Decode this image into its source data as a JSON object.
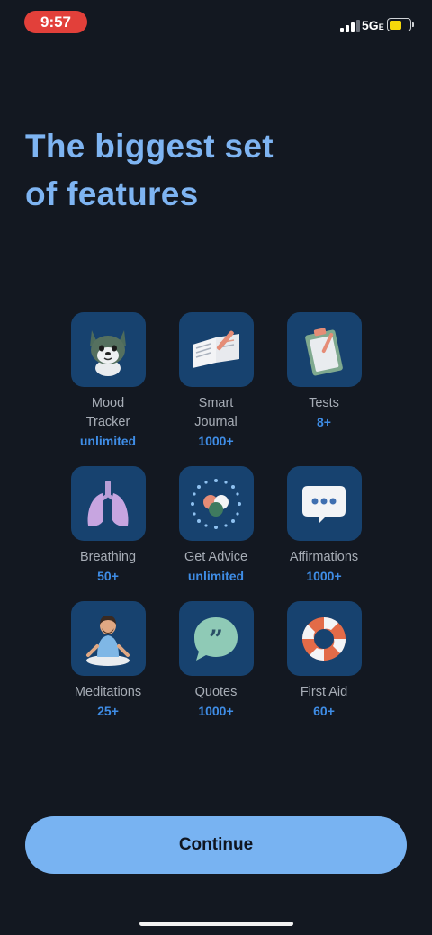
{
  "status_bar": {
    "time": "9:57",
    "network": "5G",
    "network_sub": "E",
    "battery_color": "#f5d90a"
  },
  "title_line1": "The biggest set",
  "title_line2": "of features",
  "features": [
    {
      "label_line1": "Mood",
      "label_line2": "Tracker",
      "count": "unlimited",
      "icon": "wolf-mascot-icon"
    },
    {
      "label_line1": "Smart",
      "label_line2": "Journal",
      "count": "1000+",
      "icon": "journal-icon"
    },
    {
      "label_line1": "Tests",
      "label_line2": "",
      "count": "8+",
      "icon": "clipboard-icon"
    },
    {
      "label_line1": "Breathing",
      "label_line2": "",
      "count": "50+",
      "icon": "lungs-icon"
    },
    {
      "label_line1": "Get Advice",
      "label_line2": "",
      "count": "unlimited",
      "icon": "advice-orb-icon"
    },
    {
      "label_line1": "Affirmations",
      "label_line2": "",
      "count": "1000+",
      "icon": "chat-bubble-icon"
    },
    {
      "label_line1": "Meditations",
      "label_line2": "",
      "count": "25+",
      "icon": "meditating-person-icon"
    },
    {
      "label_line1": "Quotes",
      "label_line2": "",
      "count": "1000+",
      "icon": "quote-bubble-icon"
    },
    {
      "label_line1": "First Aid",
      "label_line2": "",
      "count": "60+",
      "icon": "lifebuoy-icon"
    }
  ],
  "continue_label": "Continue",
  "colors": {
    "background": "#131821",
    "accent": "#78b3f2",
    "title": "#7eb4f2",
    "count": "#3f8de6",
    "tile": "#17426f"
  }
}
